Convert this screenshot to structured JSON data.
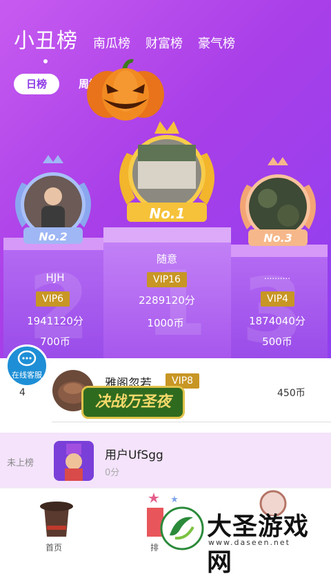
{
  "header": {
    "main_tab": "小丑榜",
    "tabs": [
      "南瓜榜",
      "财富榜",
      "豪气榜"
    ]
  },
  "period": {
    "active": "日榜",
    "inactive": "周榜"
  },
  "podium": [
    {
      "rank_badge": "No.2",
      "name": "HJH",
      "vip": "VIP6",
      "score": "1941120分",
      "coins": "700币",
      "bignum": "2"
    },
    {
      "rank_badge": "No.1",
      "name": "随意",
      "vip": "VIP16",
      "score": "2289120分",
      "coins": "1000币",
      "bignum": "1"
    },
    {
      "rank_badge": "No.3",
      "name": "..........",
      "vip": "VIP4",
      "score": "1874040分",
      "coins": "500币",
      "bignum": "3"
    }
  ],
  "customer_service": "在线客服",
  "rank4": {
    "rank": "4",
    "name": "雅阁忽若",
    "vip": "VIP8",
    "coins": "450币",
    "game_logo": "决战万圣夜"
  },
  "my_row": {
    "status": "未上榜",
    "name": "用户UfSgg",
    "score": "0分"
  },
  "nav": {
    "home": "首页",
    "rank": "排",
    "watermark": "大圣游戏网",
    "watermark_url": "www.daseen.net"
  }
}
